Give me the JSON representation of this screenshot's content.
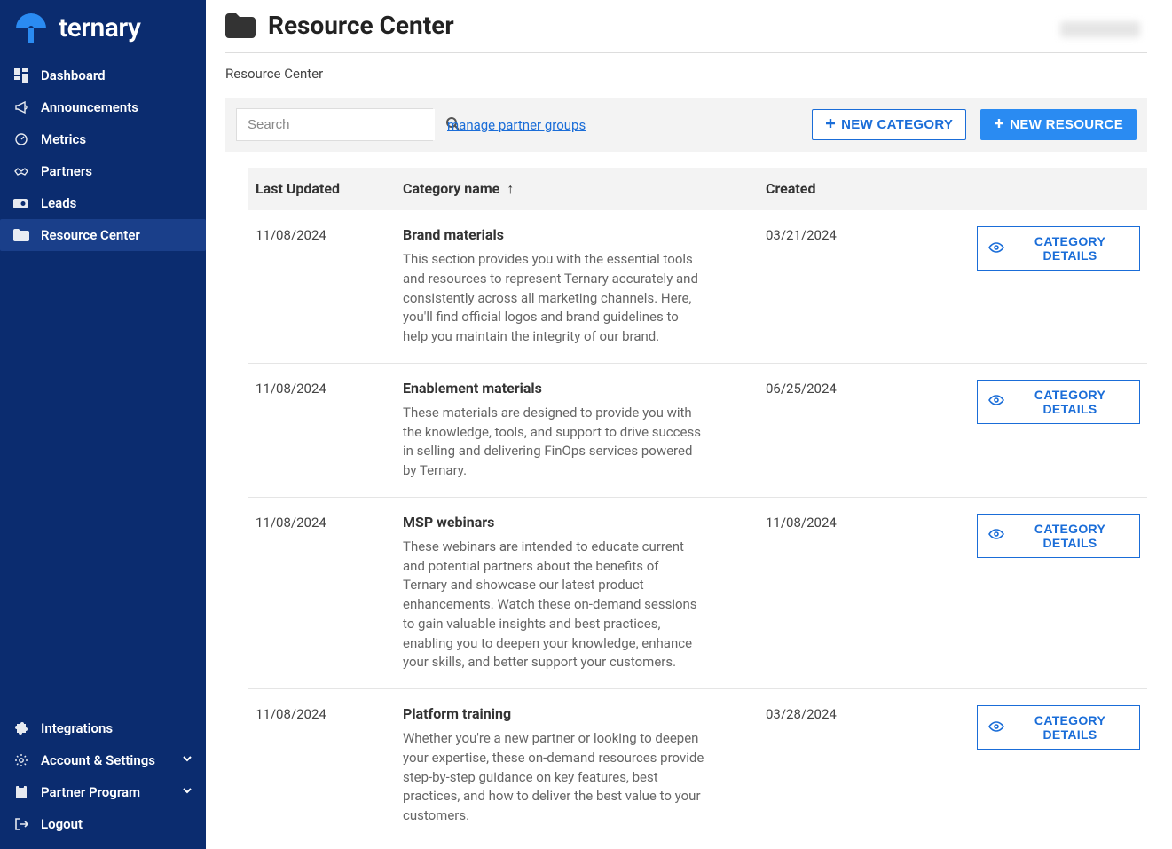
{
  "brand": {
    "name": "ternary"
  },
  "sidebar": {
    "top": [
      {
        "label": "Dashboard",
        "icon": "dashboard-icon",
        "active": false
      },
      {
        "label": "Announcements",
        "icon": "megaphone-icon",
        "active": false
      },
      {
        "label": "Metrics",
        "icon": "gauge-icon",
        "active": false
      },
      {
        "label": "Partners",
        "icon": "handshake-icon",
        "active": false
      },
      {
        "label": "Leads",
        "icon": "camera-icon",
        "active": false
      },
      {
        "label": "Resource Center",
        "icon": "folder-icon",
        "active": true
      }
    ],
    "bottom": [
      {
        "label": "Integrations",
        "icon": "puzzle-icon",
        "chevron": false
      },
      {
        "label": "Account & Settings",
        "icon": "gear-icon",
        "chevron": true
      },
      {
        "label": "Partner Program",
        "icon": "clipboard-icon",
        "chevron": true
      },
      {
        "label": "Logout",
        "icon": "logout-icon",
        "chevron": false
      }
    ]
  },
  "header": {
    "title": "Resource Center",
    "breadcrumb": "Resource Center"
  },
  "toolbar": {
    "search_placeholder": "Search",
    "manage_link": "manage partner groups",
    "new_category": "NEW CATEGORY",
    "new_resource": "NEW RESOURCE"
  },
  "table": {
    "headers": {
      "last_updated": "Last Updated",
      "category_name": "Category name",
      "created": "Created"
    },
    "sort_indicator": "↑",
    "details_label": "CATEGORY DETAILS",
    "rows": [
      {
        "last_updated": "11/08/2024",
        "name": "Brand materials",
        "desc": "This section provides you with the essential tools and resources to represent Ternary accurately and consistently across all marketing channels. Here, you'll find official logos and brand guidelines to help you maintain the integrity of our brand.",
        "created": "03/21/2024"
      },
      {
        "last_updated": "11/08/2024",
        "name": "Enablement materials",
        "desc": "These materials are designed to provide you with the knowledge, tools, and support to drive success in selling and delivering FinOps services powered by Ternary.",
        "created": "06/25/2024"
      },
      {
        "last_updated": "11/08/2024",
        "name": "MSP webinars",
        "desc": "These webinars are intended to educate current and potential partners about the benefits of Ternary and showcase our latest product enhancements. Watch these on-demand sessions to gain valuable insights and best practices, enabling you to deepen your knowledge, enhance your skills, and better support your customers.",
        "created": "11/08/2024"
      },
      {
        "last_updated": "11/08/2024",
        "name": "Platform training",
        "desc": "Whether you're a new partner or looking to deepen your expertise, these on-demand resources provide step-by-step guidance on key features, best practices, and how to deliver the best value to your customers.",
        "created": "03/28/2024"
      }
    ]
  }
}
